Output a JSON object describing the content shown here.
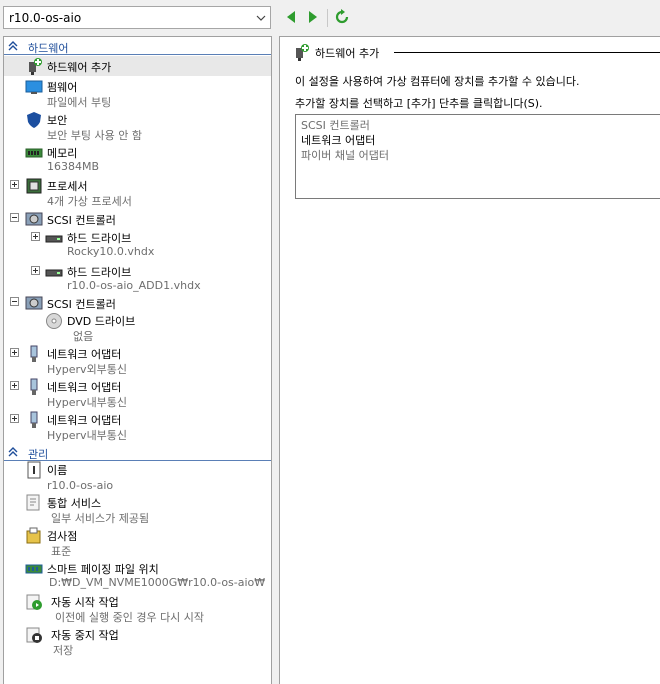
{
  "toolbar": {
    "vm_name": "r10.0-os-aio",
    "back_icon": "back-arrow-icon",
    "forward_icon": "forward-arrow-icon",
    "refresh_icon": "refresh-icon"
  },
  "colors": {
    "accent": "#1f4e9a",
    "nav_green": "#2e9c2e",
    "secondary_text": "#6d6d6d"
  },
  "hardware": {
    "header": "하드웨어",
    "items": [
      {
        "label": "하드웨어 추가",
        "sub": "",
        "icon": "add-hardware-icon"
      },
      {
        "label": "펌웨어",
        "sub": "파일에서 부팅",
        "icon": "firmware-icon"
      },
      {
        "label": "보안",
        "sub": "보안 부팅 사용 안 함",
        "icon": "shield-icon"
      },
      {
        "label": "메모리",
        "sub": "16384MB",
        "icon": "memory-icon"
      },
      {
        "label": "프로세서",
        "sub": "4개 가상 프로세서",
        "icon": "processor-icon"
      },
      {
        "label": "SCSI 컨트롤러",
        "sub": "",
        "icon": "scsi-controller-icon"
      },
      {
        "label": "하드 드라이브",
        "sub": "Rocky10.0.vhdx",
        "icon": "hard-drive-icon"
      },
      {
        "label": "하드 드라이브",
        "sub": "r10.0-os-aio_ADD1.vhdx",
        "icon": "hard-drive-icon"
      },
      {
        "label": "SCSI 컨트롤러",
        "sub": "",
        "icon": "scsi-controller-icon"
      },
      {
        "label": "DVD 드라이브",
        "sub": "없음",
        "icon": "dvd-drive-icon"
      },
      {
        "label": "네트워크 어댑터",
        "sub": "Hyperv외부통신",
        "icon": "network-adapter-icon"
      },
      {
        "label": "네트워크 어댑터",
        "sub": "Hyperv내부통신",
        "icon": "network-adapter-icon"
      },
      {
        "label": "네트워크 어댑터",
        "sub": "Hyperv내부통신",
        "icon": "network-adapter-icon"
      }
    ]
  },
  "management": {
    "header": "관리",
    "items": [
      {
        "label": "이름",
        "sub": "r10.0-os-aio",
        "icon": "name-icon"
      },
      {
        "label": "통합 서비스",
        "sub": "일부 서비스가 제공됨",
        "icon": "integration-services-icon"
      },
      {
        "label": "검사점",
        "sub": "표준",
        "icon": "checkpoint-icon"
      },
      {
        "label": "스마트 페이징 파일 위치",
        "sub": "D:₩D_VM_NVME1000G₩r10.0-os-aio₩",
        "icon": "smart-paging-icon"
      },
      {
        "label": "자동 시작 작업",
        "sub": "이전에 실행 중인 경우 다시 시작",
        "icon": "auto-start-icon"
      },
      {
        "label": "자동 중지 작업",
        "sub": "저장",
        "icon": "auto-stop-icon"
      }
    ]
  },
  "panel": {
    "title": "하드웨어 추가",
    "desc1": "이 설정을 사용하여 가상 컴퓨터에 장치를 추가할 수 있습니다.",
    "desc2": "추가할 장치를 선택하고 [추가] 단추를 클릭합니다(S).",
    "options": [
      "SCSI 컨트롤러",
      "네트워크 어댑터",
      "파이버 채널 어댑터"
    ]
  }
}
